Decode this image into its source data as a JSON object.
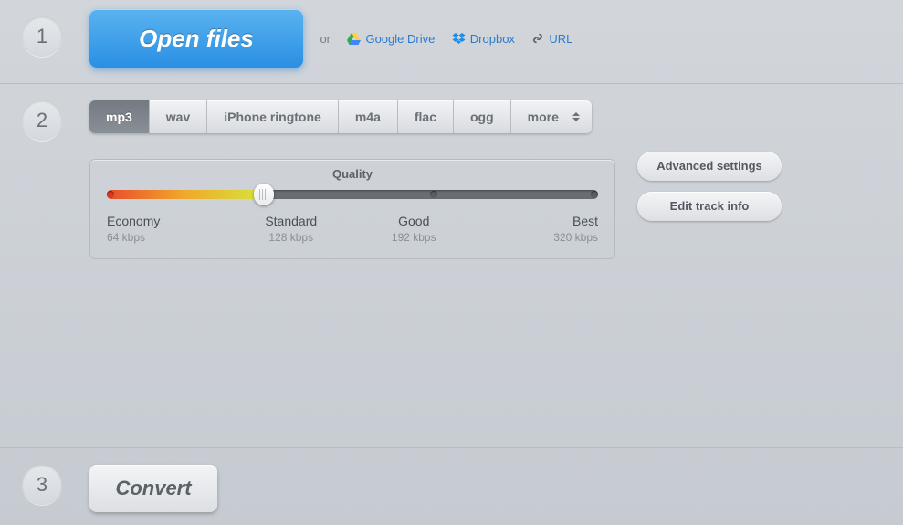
{
  "step1": {
    "number": "1",
    "open_label": "Open files",
    "or_label": "or",
    "sources": {
      "google_drive": "Google Drive",
      "dropbox": "Dropbox",
      "url": "URL"
    }
  },
  "step2": {
    "number": "2",
    "formats": {
      "mp3": "mp3",
      "wav": "wav",
      "iphone": "iPhone ringtone",
      "m4a": "m4a",
      "flac": "flac",
      "ogg": "ogg",
      "more": "more"
    },
    "selected_format": "mp3",
    "quality": {
      "title": "Quality",
      "selected_index": 1,
      "levels": [
        {
          "name": "Economy",
          "rate": "64 kbps"
        },
        {
          "name": "Standard",
          "rate": "128 kbps"
        },
        {
          "name": "Good",
          "rate": "192 kbps"
        },
        {
          "name": "Best",
          "rate": "320 kbps"
        }
      ]
    },
    "advanced_label": "Advanced settings",
    "edit_track_label": "Edit track info"
  },
  "step3": {
    "number": "3",
    "convert_label": "Convert"
  }
}
